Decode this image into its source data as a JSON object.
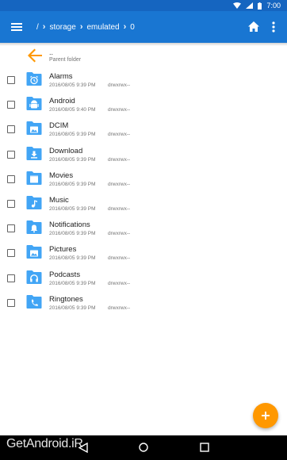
{
  "status_bar": {
    "time": "7:00"
  },
  "breadcrumb": [
    {
      "label": "/",
      "chevron_before": false
    },
    {
      "label": "storage",
      "chevron_before": true
    },
    {
      "label": "emulated",
      "chevron_before": true
    },
    {
      "label": "0",
      "chevron_before": true
    }
  ],
  "parent": {
    "label": "..",
    "sublabel": "Parent folder"
  },
  "files": [
    {
      "name": "Alarms",
      "date": "2016/08/05 9:39 PM",
      "perm": "drwxrwx--",
      "icon": "alarm-icon"
    },
    {
      "name": "Android",
      "date": "2016/08/05 9:40 PM",
      "perm": "drwxrwx--",
      "icon": "android-icon"
    },
    {
      "name": "DCIM",
      "date": "2016/08/05 9:39 PM",
      "perm": "drwxrwx--",
      "icon": "image-icon"
    },
    {
      "name": "Download",
      "date": "2016/08/05 9:39 PM",
      "perm": "drwxrwx--",
      "icon": "download-icon"
    },
    {
      "name": "Movies",
      "date": "2016/08/05 9:39 PM",
      "perm": "drwxrwx--",
      "icon": "movie-icon"
    },
    {
      "name": "Music",
      "date": "2016/08/05 9:39 PM",
      "perm": "drwxrwx--",
      "icon": "music-icon"
    },
    {
      "name": "Notifications",
      "date": "2016/08/05 9:39 PM",
      "perm": "drwxrwx--",
      "icon": "bell-icon"
    },
    {
      "name": "Pictures",
      "date": "2016/08/05 9:39 PM",
      "perm": "drwxrwx--",
      "icon": "image-icon"
    },
    {
      "name": "Podcasts",
      "date": "2016/08/05 9:39 PM",
      "perm": "drwxrwx--",
      "icon": "headphones-icon"
    },
    {
      "name": "Ringtones",
      "date": "2016/08/05 9:39 PM",
      "perm": "drwxrwx--",
      "icon": "phone-icon"
    }
  ],
  "watermark": "GetAndroid.iR",
  "colors": {
    "status_bar": "#1565c0",
    "app_bar": "#1976d2",
    "folder": "#42a5f5",
    "accent": "#ff9800"
  }
}
